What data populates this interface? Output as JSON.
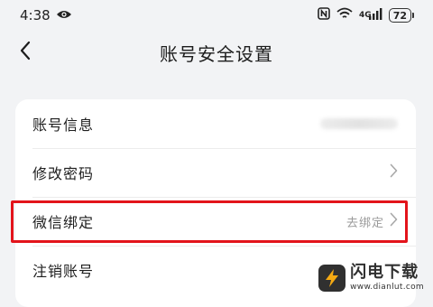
{
  "status_bar": {
    "time": "4:38",
    "network": "4G",
    "battery": "72"
  },
  "nav": {
    "title": "账号安全设置"
  },
  "settings": {
    "items": [
      {
        "label": "账号信息",
        "value": ""
      },
      {
        "label": "修改密码",
        "value": ""
      },
      {
        "label": "微信绑定",
        "value": "去绑定"
      },
      {
        "label": "注销账号",
        "value": ""
      }
    ]
  },
  "watermark": {
    "brand": "闪电下载",
    "url": "www.dianlut.com"
  }
}
